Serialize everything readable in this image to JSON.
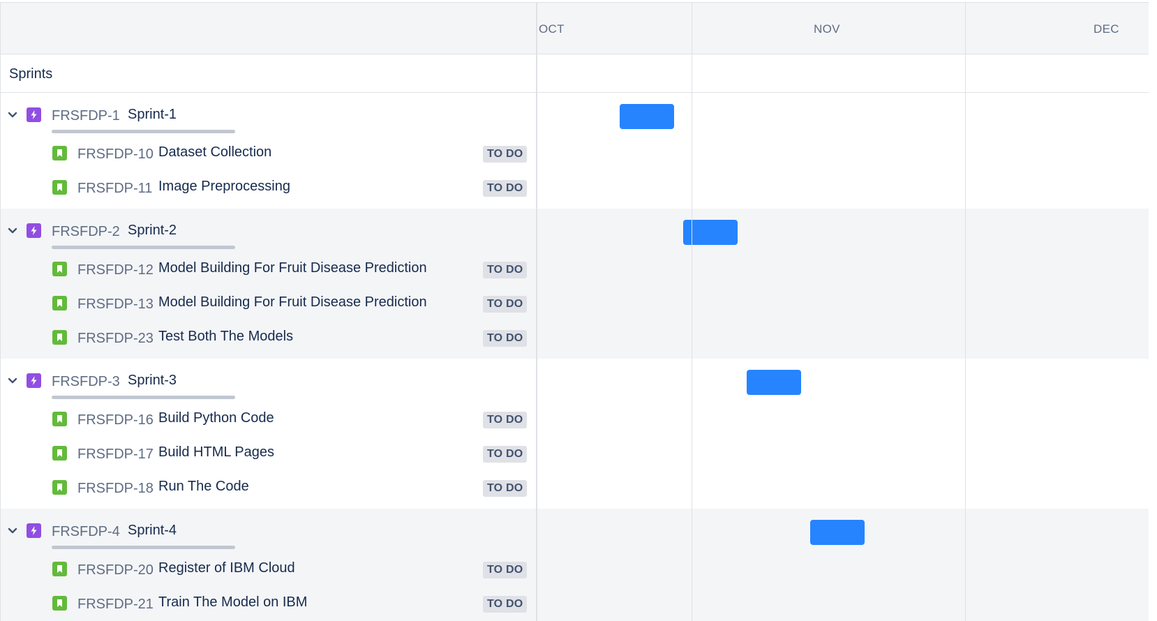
{
  "timeline": {
    "months": [
      "OCT",
      "NOV",
      "DEC"
    ]
  },
  "sprints_label": "Sprints",
  "colors": {
    "epic_icon": "#904ee2",
    "story_icon": "#63ba3c",
    "bar": "#2684ff",
    "status_bg": "#dfe1e6"
  },
  "epics": [
    {
      "key": "FRSFDP-1",
      "name": "Sprint-1",
      "issues": [
        {
          "key": "FRSFDP-10",
          "name": "Dataset Collection",
          "status": "TO DO"
        },
        {
          "key": "FRSFDP-11",
          "name": "Image Preprocessing",
          "status": "TO DO"
        }
      ]
    },
    {
      "key": "FRSFDP-2",
      "name": "Sprint-2",
      "issues": [
        {
          "key": "FRSFDP-12",
          "name": "Model Building For Fruit Disease Prediction",
          "status": "TO DO"
        },
        {
          "key": "FRSFDP-13",
          "name": "Model Building For Fruit Disease Prediction",
          "status": "TO DO"
        },
        {
          "key": "FRSFDP-23",
          "name": "Test Both The Models",
          "status": "TO DO"
        }
      ]
    },
    {
      "key": "FRSFDP-3",
      "name": "Sprint-3",
      "issues": [
        {
          "key": "FRSFDP-16",
          "name": "Build Python Code",
          "status": "TO DO"
        },
        {
          "key": "FRSFDP-17",
          "name": "Build HTML Pages",
          "status": "TO DO"
        },
        {
          "key": "FRSFDP-18",
          "name": "Run The Code",
          "status": "TO DO"
        }
      ]
    },
    {
      "key": "FRSFDP-4",
      "name": "Sprint-4",
      "issues": [
        {
          "key": "FRSFDP-20",
          "name": "Register of IBM Cloud",
          "status": "TO DO"
        },
        {
          "key": "FRSFDP-21",
          "name": "Train The Model on IBM",
          "status": "TO DO"
        }
      ]
    }
  ]
}
